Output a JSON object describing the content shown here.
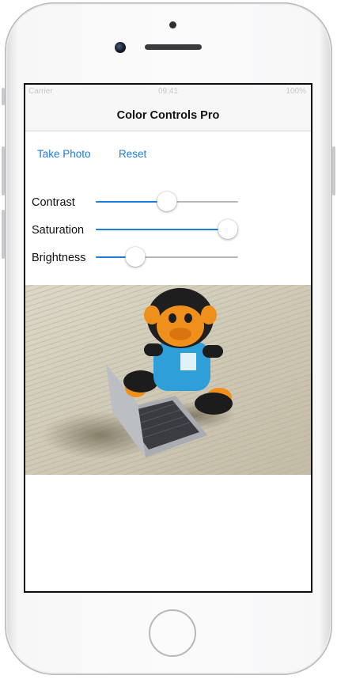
{
  "status_bar": {
    "carrier": "Carrier",
    "time": "09:41",
    "right": "100%"
  },
  "nav": {
    "title": "Color Controls Pro"
  },
  "toolbar": {
    "take_photo": "Take Photo",
    "reset": "Reset"
  },
  "sliders": [
    {
      "label": "Contrast",
      "value": 0.5
    },
    {
      "label": "Saturation",
      "value": 0.93
    },
    {
      "label": "Brightness",
      "value": 0.28
    }
  ],
  "colors": {
    "tint": "#1a7cdc",
    "track": "#b8b8b8"
  },
  "photo": {
    "description_icon": "plush-monkey-with-laptop-photo"
  }
}
